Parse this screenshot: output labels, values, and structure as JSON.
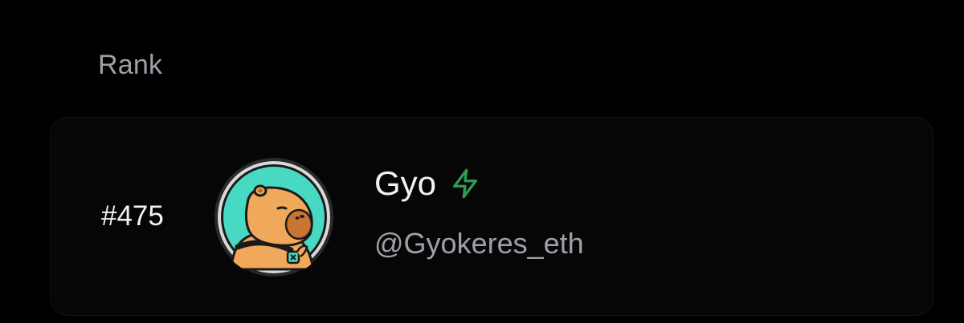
{
  "rank_section": {
    "header": "Rank"
  },
  "entry": {
    "rank": "#475",
    "display_name": "Gyo",
    "handle": "@Gyokeres_eth",
    "badge_icon": "lightning-bolt-icon",
    "badge_color": "#2e9c4f",
    "avatar_background": "#47d9c2"
  }
}
